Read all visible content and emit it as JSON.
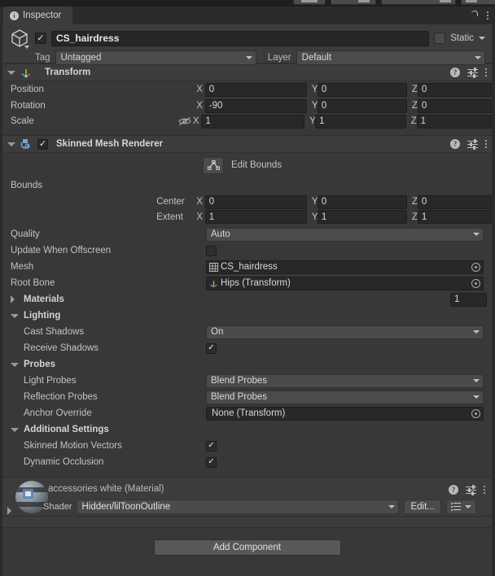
{
  "window": {
    "tab_label": "Inspector",
    "tab_icon": "info-icon",
    "lock_icon": "lock-icon",
    "menu_icon": "kebab-menu-icon"
  },
  "gameobject": {
    "icon": "cube-icon",
    "enabled": true,
    "name": "CS_hairdress",
    "static_label": "Static",
    "static_checked": false,
    "tag_label": "Tag",
    "tag_value": "Untagged",
    "layer_label": "Layer",
    "layer_value": "Default"
  },
  "transform": {
    "title": "Transform",
    "icon": "transform-axis-icon",
    "expanded": true,
    "help_icon": "help-icon",
    "preset_icon": "preset-settings-icon",
    "menu_icon": "kebab-menu-icon",
    "rows": [
      {
        "label": "Position",
        "x": "0",
        "y": "0",
        "z": "0"
      },
      {
        "label": "Rotation",
        "x": "-90",
        "y": "0",
        "z": "0"
      },
      {
        "label": "Scale",
        "x": "1",
        "y": "1",
        "z": "1",
        "constrain_icon": "eye-off-icon"
      }
    ],
    "axis_labels": [
      "X",
      "Y",
      "Z"
    ]
  },
  "skinned_mesh_renderer": {
    "title": "Skinned Mesh Renderer",
    "icon": "skinned-mesh-renderer-icon",
    "enabled": true,
    "expanded": true,
    "edit_bounds_label": "Edit Bounds",
    "edit_bounds_icon": "edit-bounds-icon",
    "bounds_label": "Bounds",
    "bounds_rows": [
      {
        "label": "Center",
        "x": "0",
        "y": "0",
        "z": "0"
      },
      {
        "label": "Extent",
        "x": "1",
        "y": "1",
        "z": "1"
      }
    ],
    "quality_label": "Quality",
    "quality_value": "Auto",
    "update_offscreen_label": "Update When Offscreen",
    "update_offscreen_checked": false,
    "mesh_label": "Mesh",
    "mesh_value": "CS_hairdress",
    "mesh_icon": "mesh-icon",
    "root_bone_label": "Root Bone",
    "root_bone_value": "Hips (Transform)",
    "root_bone_icon": "transform-axis-icon",
    "materials_label": "Materials",
    "materials_count": "1",
    "lighting": {
      "title": "Lighting",
      "cast_shadows_label": "Cast Shadows",
      "cast_shadows_value": "On",
      "receive_shadows_label": "Receive Shadows",
      "receive_shadows_checked": true
    },
    "probes": {
      "title": "Probes",
      "light_probes_label": "Light Probes",
      "light_probes_value": "Blend Probes",
      "reflection_probes_label": "Reflection Probes",
      "reflection_probes_value": "Blend Probes",
      "anchor_override_label": "Anchor Override",
      "anchor_override_value": "None (Transform)"
    },
    "additional": {
      "title": "Additional Settings",
      "skinned_motion_vectors_label": "Skinned Motion Vectors",
      "skinned_motion_vectors_checked": true,
      "dynamic_occlusion_label": "Dynamic Occlusion",
      "dynamic_occlusion_checked": true
    }
  },
  "material": {
    "title": "accessories white (Material)",
    "preview_icon": "material-sphere-icon",
    "shader_label": "Shader",
    "shader_value": "Hidden/lilToonOutline",
    "edit_button_label": "Edit...",
    "list_icon": "shader-list-icon",
    "help_icon": "help-icon",
    "preset_icon": "preset-settings-icon",
    "menu_icon": "kebab-menu-icon"
  },
  "footer": {
    "add_component_label": "Add Component"
  },
  "colors": {
    "panel_bg": "#383838",
    "header_bg": "#3c3c3c",
    "field_bg": "#282828",
    "dropdown_bg": "#4b4b4b",
    "text": "#c4c4c4",
    "tabbar_bg": "#2b2b2b"
  }
}
